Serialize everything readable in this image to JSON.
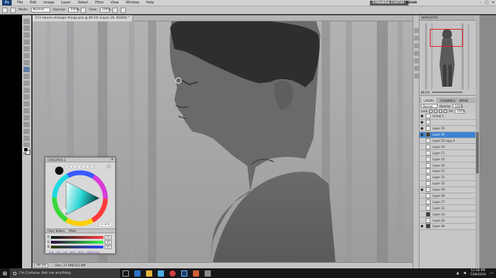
{
  "menubar": {
    "logo": "Ps",
    "items": [
      "File",
      "Edit",
      "Image",
      "Layer",
      "Select",
      "Filter",
      "View",
      "Window",
      "Help"
    ],
    "workspace_active": "FORANDA CUSTOM",
    "workspace_design": "DESIGN",
    "window_buttons": [
      "–",
      "□",
      "✕"
    ]
  },
  "optionsbar": {
    "mode_label": "Mode:",
    "mode_value": "Normal",
    "opacity_label": "Opacity:",
    "opacity_value": "100%",
    "flow_label": "Flow:",
    "flow_value": "100%"
  },
  "document": {
    "tab_title": "111 eleven stranger things.psd @ 89.5% (Layer 26, RGB/8) *",
    "zoom": "89.5%",
    "doc_size": "Doc: 27.0M/322.8M"
  },
  "navigator": {
    "title": "NAVIGATOR",
    "zoom": "89.5%"
  },
  "layers": {
    "tabs": [
      "LAYERS",
      "CHANNELS",
      "PATHS"
    ],
    "blend_mode": "Normal",
    "opacity_label": "Opacity:",
    "opacity_value": "100%",
    "lock_label": "Lock:",
    "fill_label": "Fill:",
    "fill_value": "100%",
    "rows": [
      {
        "name": "Group 1",
        "eye": "●",
        "dark": false,
        "selected": false
      },
      {
        "name": "",
        "eye": "●",
        "dark": false,
        "selected": false
      },
      {
        "name": "Layer 35",
        "eye": "●",
        "dark": false,
        "selected": false
      },
      {
        "name": "Layer 26",
        "eye": "●",
        "dark": true,
        "selected": true
      },
      {
        "name": "Layer 25 copy 4",
        "eye": "",
        "dark": false,
        "selected": false
      },
      {
        "name": "Layer 19",
        "eye": "",
        "dark": false,
        "selected": false
      },
      {
        "name": "Layer 17",
        "eye": "",
        "dark": false,
        "selected": false
      },
      {
        "name": "Layer 16",
        "eye": "",
        "dark": false,
        "selected": false
      },
      {
        "name": "Layer 14",
        "eye": "",
        "dark": false,
        "selected": false
      },
      {
        "name": "Layer 13",
        "eye": "",
        "dark": false,
        "selected": false
      },
      {
        "name": "Layer 31",
        "eye": "",
        "dark": false,
        "selected": false
      },
      {
        "name": "Layer 32",
        "eye": "",
        "dark": false,
        "selected": false
      },
      {
        "name": "Layer 29",
        "eye": "●",
        "dark": false,
        "selected": false
      },
      {
        "name": "Layer 28",
        "eye": "",
        "dark": false,
        "selected": false
      },
      {
        "name": "Layer 27",
        "eye": "",
        "dark": false,
        "selected": false
      },
      {
        "name": "Layer 22",
        "eye": "",
        "dark": false,
        "selected": false
      },
      {
        "name": "Layer 23",
        "eye": "",
        "dark": true,
        "selected": false
      },
      {
        "name": "Layer 20",
        "eye": "",
        "dark": false,
        "selected": false
      },
      {
        "name": "Layer 40",
        "eye": "●",
        "dark": true,
        "selected": false
      }
    ]
  },
  "colorwheel": {
    "title": "COOLORUS 2",
    "close": "✕",
    "hex_value": "2C3F3F",
    "sliders_tabs": [
      "Color Sliders",
      "Mixer"
    ],
    "sliders": [
      {
        "name": "R",
        "value": "45",
        "gradient": "linear-gradient(90deg,#001c1c,#ff3c3c)"
      },
      {
        "name": "G",
        "value": "63",
        "gradient": "linear-gradient(90deg,#2d003f,#2dff3f)"
      },
      {
        "name": "B",
        "value": "63",
        "gradient": "linear-gradient(90deg,#2d3f00,#2d3fff)"
      }
    ],
    "modes": [
      "RGB",
      "HSV",
      "LAB",
      "CMYK",
      "HSV#",
      "GRAYSCALE"
    ]
  },
  "taskbar": {
    "start_icon": "⊞",
    "cortana_text": "I'm Cortana. Ask me anything.",
    "time": "12:58 PM",
    "date": "7/28/2016"
  }
}
